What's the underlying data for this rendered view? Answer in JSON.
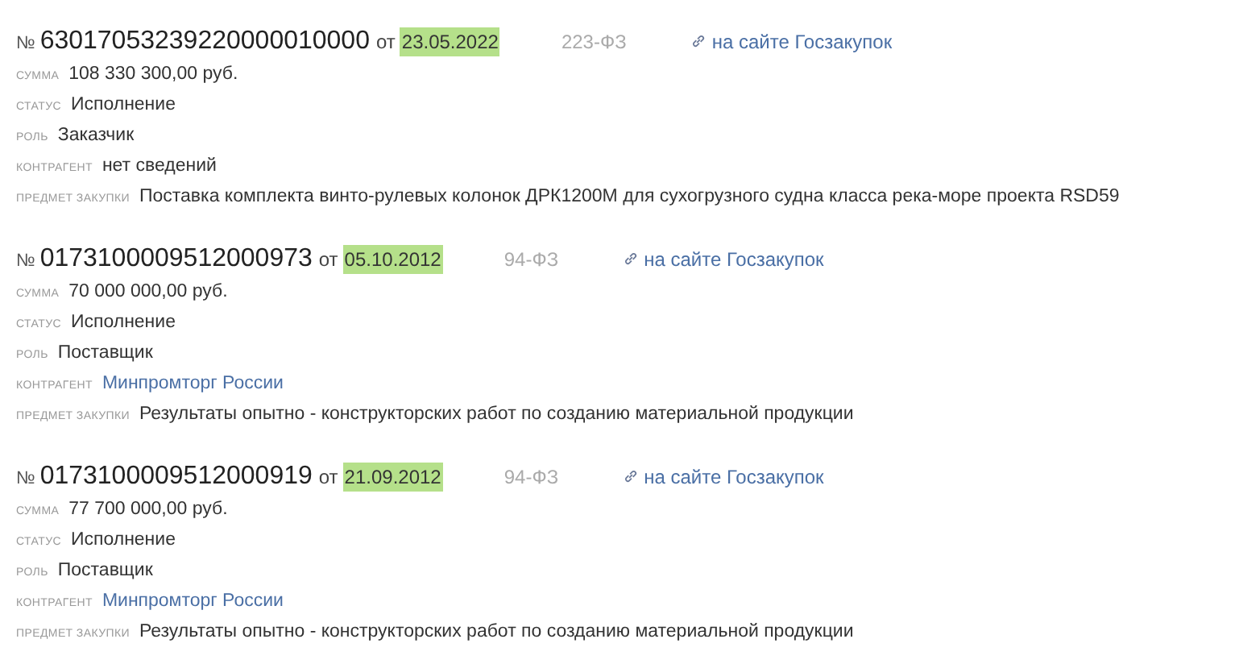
{
  "contracts": [
    {
      "number_sign": "№",
      "number": "63017053239220000010000",
      "from": "от",
      "date": "23.05.2022",
      "law": "223-ФЗ",
      "link": "на сайте Госзакупок",
      "fields": [
        {
          "label": "СУММА",
          "value": "108 330 300,00 руб.",
          "kind": "text"
        },
        {
          "label": "СТАТУС",
          "value": "Исполнение",
          "kind": "text"
        },
        {
          "label": "РОЛЬ",
          "value": "Заказчик",
          "kind": "text"
        },
        {
          "label": "КОНТРАГЕНТ",
          "value": "нет сведений",
          "kind": "text"
        },
        {
          "label": "ПРЕДМЕТ ЗАКУПКИ",
          "value": "Поставка комплекта винто-рулевых колонок ДРК1200М для сухогрузного судна класса река-море проекта RSD59",
          "kind": "text"
        }
      ]
    },
    {
      "number_sign": "№",
      "number": "0173100009512000973",
      "from": "от",
      "date": "05.10.2012",
      "law": "94-ФЗ",
      "link": "на сайте Госзакупок",
      "fields": [
        {
          "label": "СУММА",
          "value": "70 000 000,00 руб.",
          "kind": "text"
        },
        {
          "label": "СТАТУС",
          "value": "Исполнение",
          "kind": "text"
        },
        {
          "label": "РОЛЬ",
          "value": "Поставщик",
          "kind": "text"
        },
        {
          "label": "КОНТРАГЕНТ",
          "value": "Минпромторг России",
          "kind": "link"
        },
        {
          "label": "ПРЕДМЕТ ЗАКУПКИ",
          "value": "Результаты опытно - конструкторских работ по созданию материальной продукции",
          "kind": "text"
        }
      ]
    },
    {
      "number_sign": "№",
      "number": "0173100009512000919",
      "from": "от",
      "date": "21.09.2012",
      "law": "94-ФЗ",
      "link": "на сайте Госзакупок",
      "fields": [
        {
          "label": "СУММА",
          "value": "77 700 000,00 руб.",
          "kind": "text"
        },
        {
          "label": "СТАТУС",
          "value": "Исполнение",
          "kind": "text"
        },
        {
          "label": "РОЛЬ",
          "value": "Поставщик",
          "kind": "text"
        },
        {
          "label": "КОНТРАГЕНТ",
          "value": "Минпромторг России",
          "kind": "link"
        },
        {
          "label": "ПРЕДМЕТ ЗАКУПКИ",
          "value": "Результаты опытно - конструкторских работ по созданию материальной продукции",
          "kind": "text"
        }
      ]
    }
  ]
}
